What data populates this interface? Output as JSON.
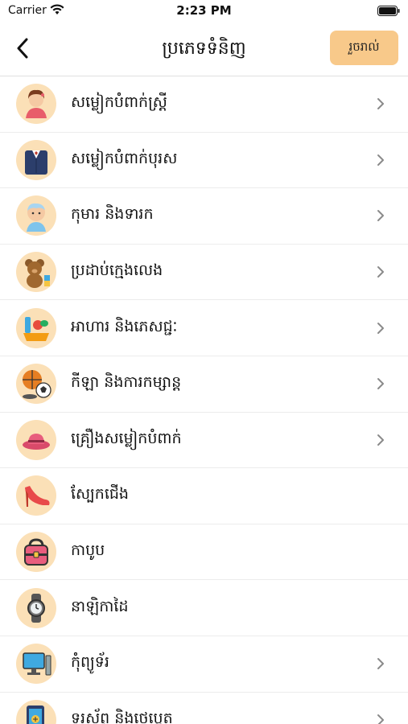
{
  "status": {
    "carrier": "Carrier",
    "time": "2:23 PM"
  },
  "nav": {
    "title": "ប្រភេទទំនិញ",
    "done_label": "រួចរាល់"
  },
  "categories": [
    {
      "label": "សម្លៀកបំពាក់ស្ត្រី",
      "icon": "woman-icon",
      "chevron": true
    },
    {
      "label": "សម្លៀកបំពាក់បុរស",
      "icon": "suit-icon",
      "chevron": true
    },
    {
      "label": "កុមារ និងទារក",
      "icon": "baby-icon",
      "chevron": true
    },
    {
      "label": "ប្រដាប់ក្មេងលេង",
      "icon": "teddy-bear-icon",
      "chevron": true
    },
    {
      "label": "អាហារ និងភេសជ្ជៈ",
      "icon": "groceries-icon",
      "chevron": true
    },
    {
      "label": "កីឡា និងការកម្សាន្ត",
      "icon": "sports-balls-icon",
      "chevron": true
    },
    {
      "label": "គ្រឿងសម្លៀកបំពាក់",
      "icon": "hat-icon",
      "chevron": true
    },
    {
      "label": "ស្បែកជើង",
      "icon": "high-heel-icon",
      "chevron": false
    },
    {
      "label": "កាបូប",
      "icon": "bag-icon",
      "chevron": false
    },
    {
      "label": "នាឡិកាដៃ",
      "icon": "watch-icon",
      "chevron": false
    },
    {
      "label": "កុំព្យូទ័រ",
      "icon": "computer-icon",
      "chevron": true
    },
    {
      "label": "ទូរស័ព្ទ និងថេប្លេត",
      "icon": "phone-icon",
      "chevron": true
    }
  ],
  "colors": {
    "accent": "#f8c98a",
    "icon_bg": "#fbe0b7"
  }
}
